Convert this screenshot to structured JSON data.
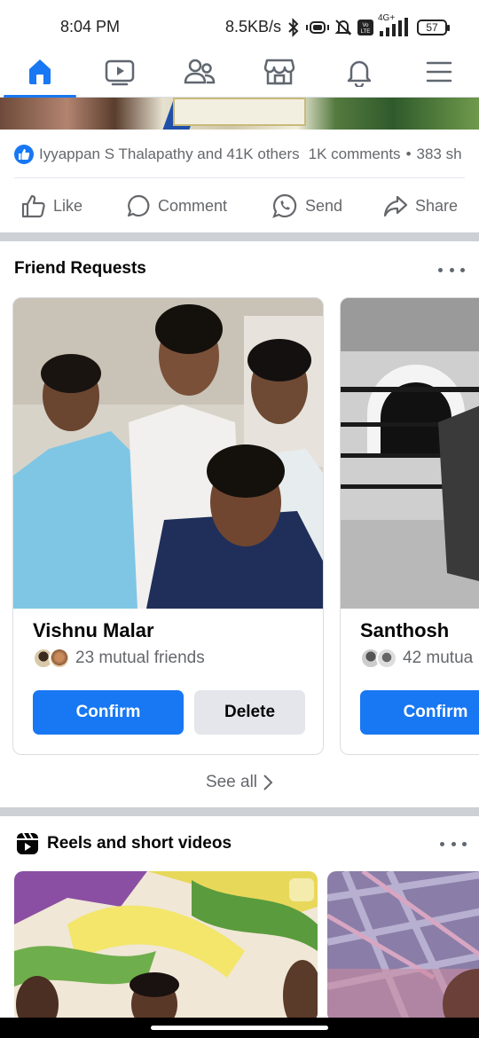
{
  "status_bar": {
    "time": "8:04 PM",
    "net_speed": "8.5KB/s",
    "network_label": "4G+",
    "battery": "57",
    "icons": [
      "bluetooth-icon",
      "vibrate-icon",
      "mute-icon",
      "volte-icon",
      "signal-icon",
      "battery-icon"
    ]
  },
  "nav": {
    "items": [
      {
        "name": "home-icon",
        "active": true
      },
      {
        "name": "video-icon",
        "active": false
      },
      {
        "name": "friends-icon",
        "active": false
      },
      {
        "name": "marketplace-icon",
        "active": false
      },
      {
        "name": "notifications-icon",
        "active": false
      },
      {
        "name": "menu-icon",
        "active": false
      }
    ],
    "accent": "#1877f2"
  },
  "post": {
    "reactions_text": "Iyyappan S Thalapathy and 41K others",
    "comments_text": "1K comments",
    "shares_text": "383 sh",
    "actions": {
      "like": "Like",
      "comment": "Comment",
      "send": "Send",
      "share": "Share"
    }
  },
  "friend_requests": {
    "title": "Friend Requests",
    "cards": [
      {
        "name": "Vishnu Malar",
        "mutual": "23 mutual friends",
        "confirm": "Confirm",
        "delete": "Delete"
      },
      {
        "name": "Santhosh",
        "mutual": "42 mutua",
        "confirm": "Confirm"
      }
    ],
    "see_all": "See all"
  },
  "reels": {
    "title": "Reels and short videos"
  }
}
